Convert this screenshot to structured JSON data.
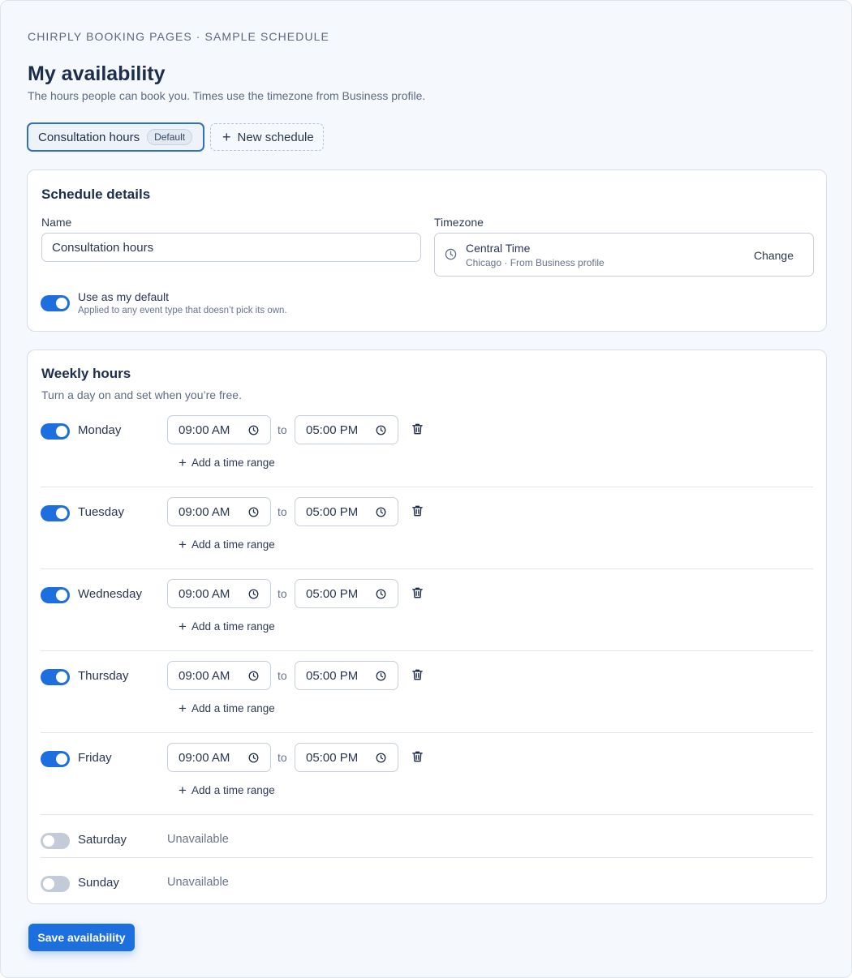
{
  "header": {
    "breadcrumb": "CHIRPLY BOOKING PAGES · SAMPLE SCHEDULE",
    "title": "My availability",
    "subtitle": "The hours people can book you. Times use the timezone from Business profile."
  },
  "tabs": {
    "active_label": "Consultation hours",
    "active_badge": "Default",
    "new_label": "New schedule"
  },
  "details": {
    "title": "Schedule details",
    "name_label": "Name",
    "name_value": "Consultation hours",
    "timezone_label": "Timezone",
    "timezone_name": "Central Time",
    "timezone_sub": "Chicago · From Business profile",
    "timezone_change": "Change",
    "default_label": "Use as my default",
    "default_help": "Applied to any event type that doesn’t pick its own."
  },
  "weekly": {
    "title": "Weekly hours",
    "help": "Turn a day on and set when you’re free.",
    "to_label": "to",
    "add_range_label": "Add a time range",
    "unavailable_label": "Unavailable",
    "days": [
      {
        "name": "Monday",
        "enabled": true,
        "from": "09:00 AM",
        "to": "05:00 PM"
      },
      {
        "name": "Tuesday",
        "enabled": true,
        "from": "09:00 AM",
        "to": "05:00 PM"
      },
      {
        "name": "Wednesday",
        "enabled": true,
        "from": "09:00 AM",
        "to": "05:00 PM"
      },
      {
        "name": "Thursday",
        "enabled": true,
        "from": "09:00 AM",
        "to": "05:00 PM"
      },
      {
        "name": "Friday",
        "enabled": true,
        "from": "09:00 AM",
        "to": "05:00 PM"
      },
      {
        "name": "Saturday",
        "enabled": false
      },
      {
        "name": "Sunday",
        "enabled": false
      }
    ]
  },
  "footer": {
    "save_label": "Save availability"
  },
  "colors": {
    "accent": "#1d6fe0",
    "toggle_off": "#c4cbd8"
  },
  "icons": {
    "timezone": "clock-icon",
    "time_input": "clock-icon",
    "remove": "trash-icon",
    "add": "plus-icon"
  }
}
